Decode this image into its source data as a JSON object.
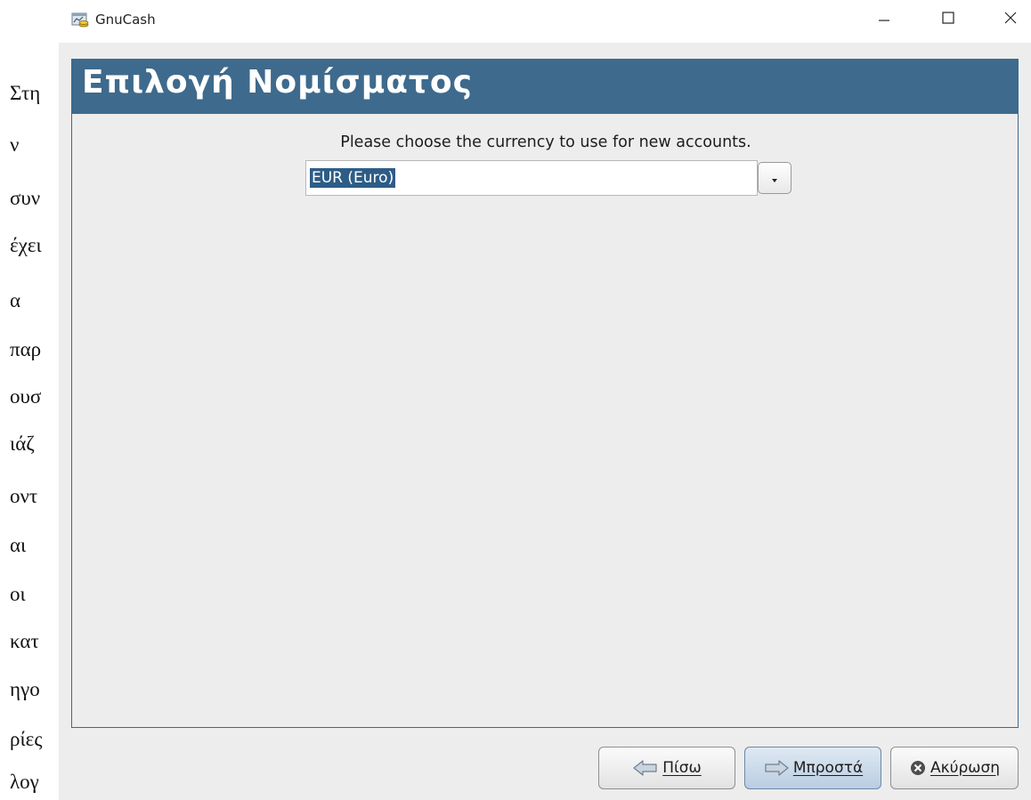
{
  "document": {
    "side_words": [
      "Στη",
      "ν",
      "συν",
      "έχει",
      "α",
      "παρ",
      "ουσ",
      "ιάζ",
      "οντ",
      "αι",
      "οι",
      "κατ",
      "ηγο",
      "ρίες",
      "λογ"
    ]
  },
  "window": {
    "title": "GnuCash",
    "app_icon": "gnucash-icon",
    "controls": [
      "minimize-icon",
      "maximize-icon",
      "close-icon"
    ]
  },
  "banner": {
    "title": "Επιλογή Νομίσματος",
    "color": "#3e6a8d"
  },
  "content": {
    "prompt": "Please choose the currency to use for new accounts.",
    "currency_select": {
      "value": "EUR (Euro)"
    }
  },
  "buttons": {
    "back": {
      "label": "Πίσω",
      "icon": "arrow-left-icon"
    },
    "forward": {
      "label": "Μπροστά",
      "icon": "arrow-right-icon"
    },
    "cancel": {
      "label": "Ακύρωση",
      "icon": "cancel-icon"
    }
  }
}
